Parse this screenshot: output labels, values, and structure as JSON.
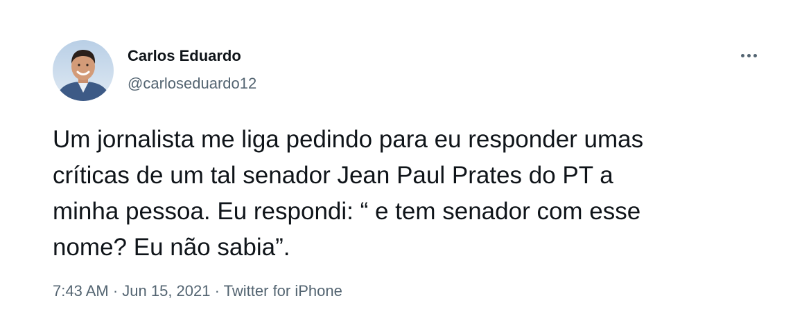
{
  "author": {
    "display_name": "Carlos Eduardo",
    "handle": "@carloseduardo12",
    "avatar_icon": "profile-photo"
  },
  "more_icon": "more-horizontal-icon",
  "tweet": {
    "text_lines": [
      "Um jornalista me liga pedindo para eu responder umas",
      "críticas de um tal senador Jean Paul Prates do PT a",
      "minha pessoa. Eu respondi: “ e tem senador com esse",
      "nome? Eu não sabia”."
    ]
  },
  "meta": {
    "time": "7:43 AM",
    "separator": " · ",
    "date": "Jun 15, 2021",
    "source": "Twitter for iPhone"
  },
  "colors": {
    "text_primary": "#0f1419",
    "text_secondary": "#536471",
    "background": "#ffffff"
  }
}
